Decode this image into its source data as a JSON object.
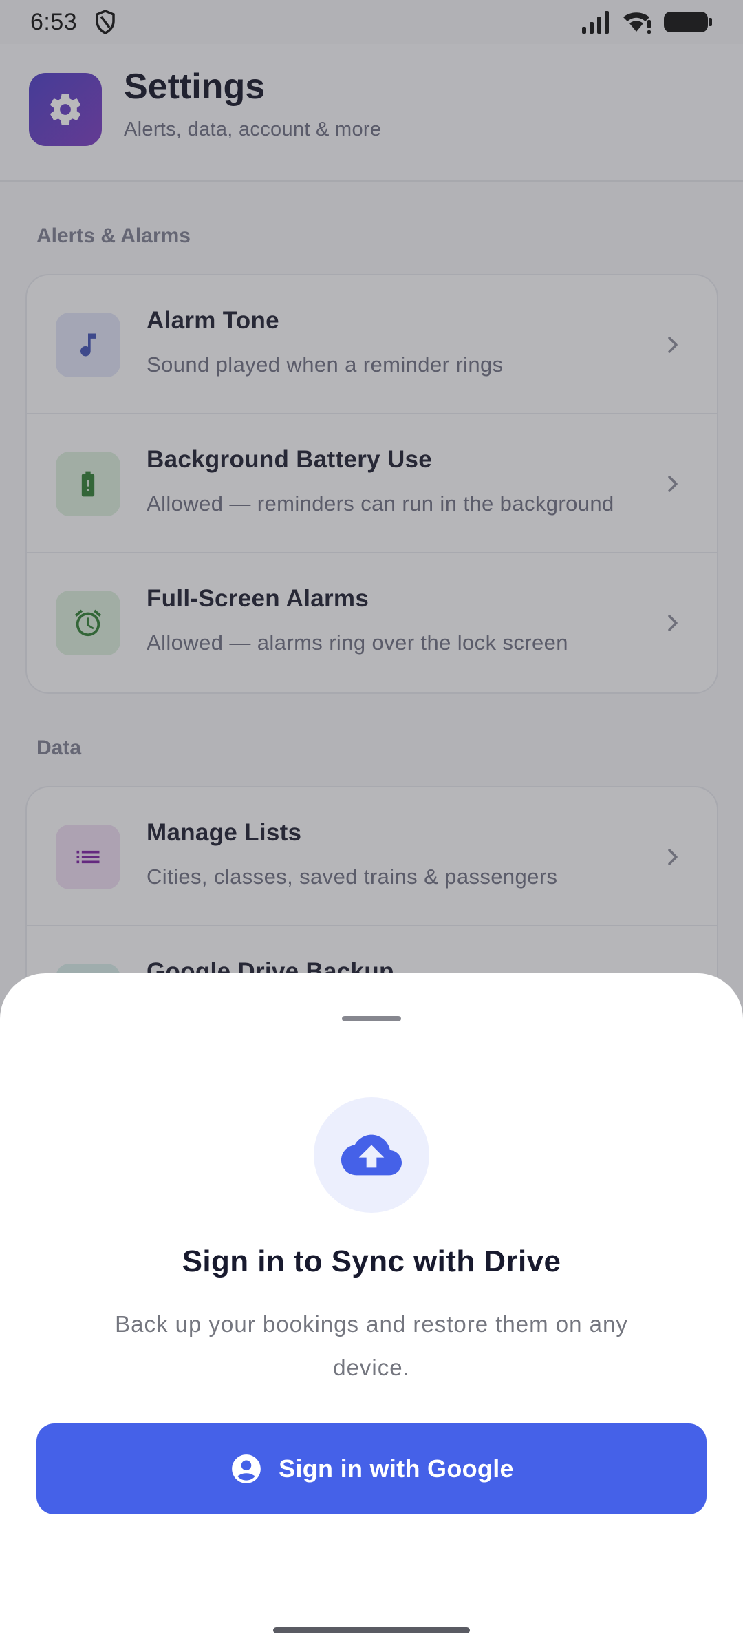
{
  "status_bar": {
    "time": "6:53",
    "icons": [
      "shield-icon",
      "signal-icon",
      "wifi-icon",
      "battery-icon"
    ]
  },
  "header": {
    "title": "Settings",
    "subtitle": "Alerts, data, account & more",
    "icon": "gear-icon"
  },
  "sections": {
    "alerts": {
      "label": "Alerts & Alarms",
      "items": [
        {
          "title": "Alarm Tone",
          "subtitle": "Sound played when a reminder rings",
          "icon": "music-note-icon",
          "icon_color": "#3f51b5",
          "icon_bg": "#dfe2f6"
        },
        {
          "title": "Background Battery Use",
          "subtitle": "Allowed — reminders can run in the background",
          "icon": "battery-icon",
          "icon_color": "#2e7d32",
          "icon_bg": "#d9ecdb"
        },
        {
          "title": "Full-Screen Alarms",
          "subtitle": "Allowed — alarms ring over the lock screen",
          "icon": "alarm-clock-icon",
          "icon_color": "#2e7d32",
          "icon_bg": "#d9ecdb"
        }
      ]
    },
    "data": {
      "label": "Data",
      "items": [
        {
          "title": "Manage Lists",
          "subtitle": "Cities, classes, saved trains & passengers",
          "icon": "list-icon",
          "icon_color": "#7b1fa2",
          "icon_bg": "#eddcf1"
        },
        {
          "title": "Google Drive Backup",
          "subtitle": "",
          "icon": "drive-icon",
          "icon_color": "#00897b",
          "icon_bg": "#d6ecea"
        }
      ]
    }
  },
  "sheet": {
    "icon": "cloud-upload-icon",
    "title": "Sign in to Sync with Drive",
    "body": "Back up your bookings and restore them on any device.",
    "button_label": "Sign in with Google",
    "button_icon": "account-circle-icon"
  },
  "colors": {
    "accent": "#4561e8",
    "app_icon_gradient": [
      "#4b3cc6",
      "#7a3bc0"
    ],
    "scrim": "rgba(60,60,66,0.36)"
  }
}
